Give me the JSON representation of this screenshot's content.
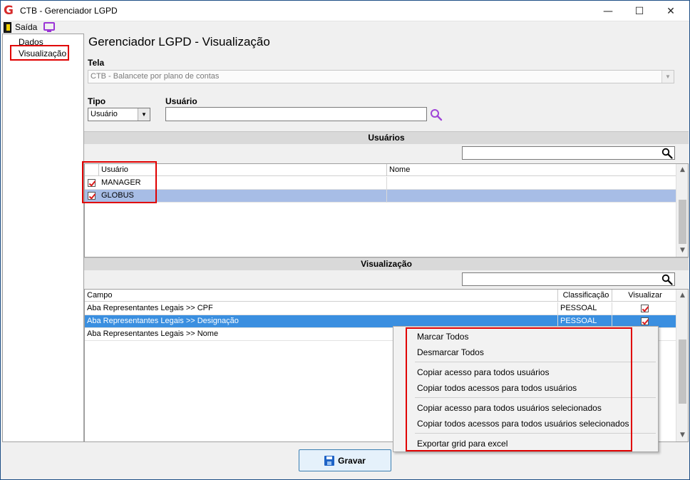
{
  "window": {
    "title": "CTB - Gerenciador LGPD",
    "logo_glyph": "G",
    "minimize_glyph": "—",
    "maximize_glyph": "☐",
    "close_glyph": "✕"
  },
  "menubar": {
    "exit_label": "Saída"
  },
  "tree": {
    "items": [
      {
        "label": "Dados"
      },
      {
        "label": "Visualização"
      }
    ]
  },
  "page": {
    "title": "Gerenciador LGPD - Visualização"
  },
  "form": {
    "tela_label": "Tela",
    "tela_value": "CTB - Balancete por plano de contas",
    "tipo_label": "Tipo",
    "tipo_value": "Usuário",
    "usuario_label": "Usuário",
    "usuario_value": ""
  },
  "users_section": {
    "title": "Usuários",
    "filter_value": "",
    "columns": [
      "Usuário",
      "Nome"
    ],
    "rows": [
      {
        "checked": true,
        "usuario": "MANAGER",
        "nome": ""
      },
      {
        "checked": true,
        "usuario": "GLOBUS",
        "nome": ""
      }
    ]
  },
  "visualizacao_section": {
    "title": "Visualização",
    "filter_value": "",
    "columns": [
      "Campo",
      "Classificação",
      "Visualizar"
    ],
    "rows": [
      {
        "campo": "Aba Representantes Legais >> CPF",
        "classificacao": "PESSOAL",
        "visualizar": true
      },
      {
        "campo": "Aba Representantes Legais >> Designação",
        "classificacao": "PESSOAL",
        "visualizar": true
      },
      {
        "campo": "Aba Representantes Legais >> Nome",
        "classificacao": "",
        "visualizar": false
      }
    ]
  },
  "context_menu": {
    "items": [
      "Marcar Todos",
      "Desmarcar Todos",
      "Copiar acesso para todos usuários",
      "Copiar todos acessos para todos usuários",
      "Copiar acesso para todos usuários selecionados",
      "Copiar todos acessos para todos usuários selecionados",
      "Exportar grid para excel"
    ]
  },
  "footer": {
    "save_label": "Gravar"
  },
  "colors": {
    "highlight_box": "#e00000",
    "selected_row_dark": "#3a8fe0",
    "selected_row_light": "#a7bde6",
    "check_mark": "#d81c1c",
    "accent_purple": "#9b34d6"
  },
  "icons": {
    "exit": "door-exit-icon",
    "screen": "monitor-icon",
    "search": "search-icon",
    "save": "floppy-disk-icon"
  }
}
